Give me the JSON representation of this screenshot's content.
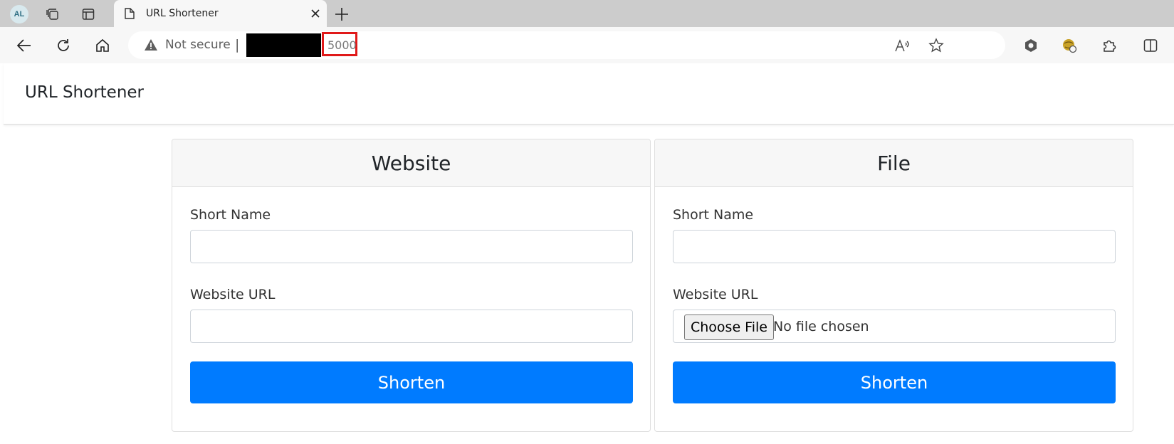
{
  "browser": {
    "profile_initials": "AL",
    "tab": {
      "title": "URL Shortener",
      "icon": "page-icon"
    },
    "address": {
      "security_label": "Not secure",
      "separator": "|",
      "port": "5000"
    }
  },
  "page": {
    "brand": "URL Shortener",
    "website_card": {
      "header": "Website",
      "short_name_label": "Short Name",
      "short_name_value": "",
      "url_label": "Website URL",
      "url_value": "",
      "button_label": "Shorten"
    },
    "file_card": {
      "header": "File",
      "short_name_label": "Short Name",
      "short_name_value": "",
      "url_label": "Website URL",
      "choose_file_label": "Choose File",
      "file_status": "No file chosen",
      "button_label": "Shorten"
    }
  },
  "colors": {
    "primary": "#007bff",
    "highlight_box": "#e01919",
    "tabstrip": "#cccccc",
    "toolbar": "#f7f7f7"
  }
}
